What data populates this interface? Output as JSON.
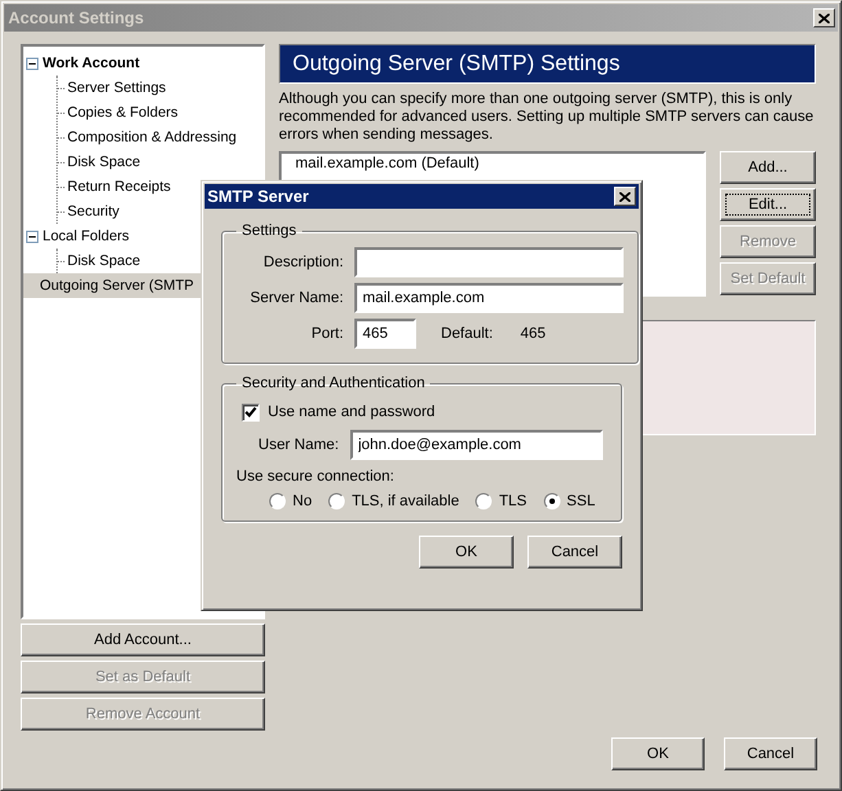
{
  "window": {
    "title": "Account Settings"
  },
  "tree": [
    {
      "label": "Work Account",
      "bold": true,
      "expanded": true,
      "selected": false,
      "children": [
        {
          "label": "Server Settings",
          "selected": false
        },
        {
          "label": "Copies & Folders",
          "selected": false
        },
        {
          "label": "Composition & Addressing",
          "selected": false
        },
        {
          "label": "Disk Space",
          "selected": false
        },
        {
          "label": "Return Receipts",
          "selected": false
        },
        {
          "label": "Security",
          "selected": false
        }
      ]
    },
    {
      "label": "Local Folders",
      "bold": false,
      "expanded": true,
      "selected": false,
      "children": [
        {
          "label": "Disk Space",
          "selected": false
        }
      ]
    },
    {
      "label": "Outgoing Server (SMTP",
      "bold": false,
      "selected": true
    }
  ],
  "account_buttons": [
    {
      "label": "Add Account...",
      "disabled": false
    },
    {
      "label": "Set as Default",
      "disabled": true
    },
    {
      "label": "Remove Account",
      "disabled": true
    }
  ],
  "panel": {
    "heading": "Outgoing Server (SMTP) Settings",
    "description": "Although you can specify more than one outgoing server (SMTP), this is only recommended for advanced users. Setting up multiple SMTP servers can cause errors when sending messages.",
    "servers": [
      {
        "label": "mail.example.com (Default)",
        "selected": false
      }
    ],
    "buttons": [
      {
        "label": "Add...",
        "disabled": false,
        "focused": false
      },
      {
        "label": "Edit...",
        "disabled": false,
        "focused": true
      },
      {
        "label": "Remove",
        "disabled": true,
        "focused": false
      },
      {
        "label": "Set Default",
        "disabled": true,
        "focused": false
      }
    ]
  },
  "footer_buttons": [
    "OK",
    "Cancel"
  ],
  "dialog": {
    "title": "SMTP Server",
    "settings": {
      "title": "Settings",
      "fields": [
        {
          "label": "Description:"
        },
        {
          "label": "Server Name:",
          "value": "mail.example.com"
        }
      ],
      "port": {
        "label": "Port:",
        "value": "465",
        "default_label": "Default:",
        "default_value": "465"
      }
    },
    "security": {
      "title": "Security and Authentication",
      "checkbox": {
        "label": "Use name and password",
        "checked": true
      },
      "user_name": {
        "label": "User Name:",
        "value": "john.doe@example.com"
      },
      "connection_label": "Use secure connection:",
      "radios": [
        {
          "label": "No",
          "selected": false
        },
        {
          "label": "TLS, if available",
          "selected": false
        },
        {
          "label": "TLS",
          "selected": false
        },
        {
          "label": "SSL",
          "selected": true
        }
      ]
    },
    "buttons": [
      "OK",
      "Cancel"
    ]
  }
}
